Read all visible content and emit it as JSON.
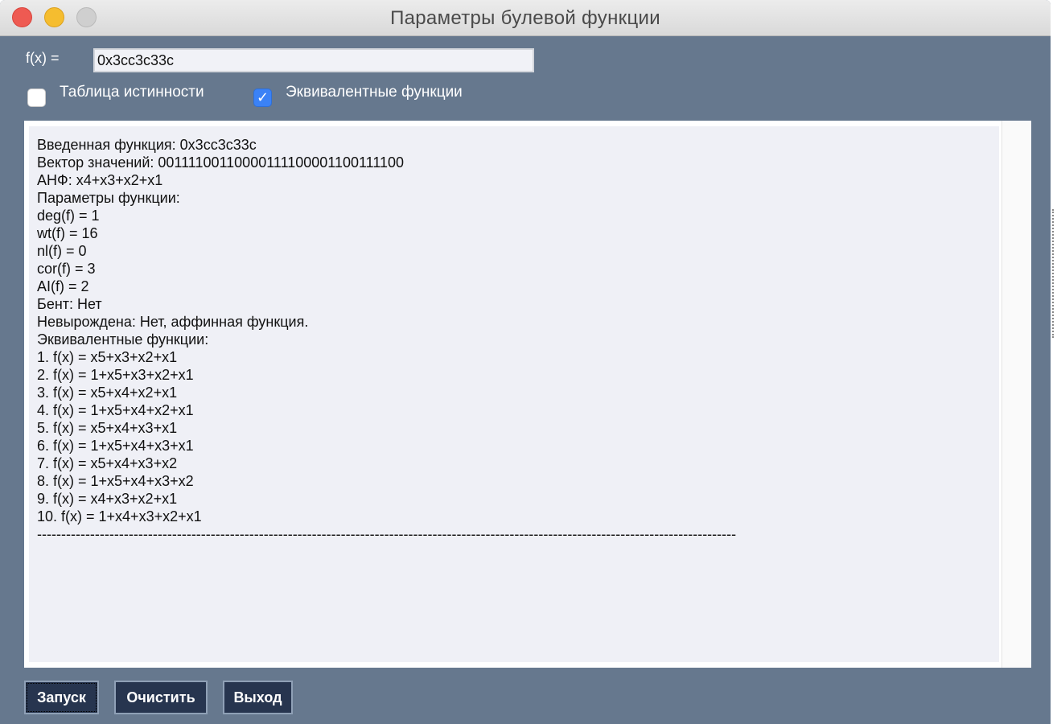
{
  "window": {
    "title": "Параметры булевой функции"
  },
  "form": {
    "fx_label": "f(x) =",
    "fx_value": "0x3cc3c33c"
  },
  "options": {
    "truth_table": {
      "label": "Таблица истинности",
      "checked": false
    },
    "equivalent": {
      "label": "Эквивалентные функции",
      "checked": true
    }
  },
  "output": {
    "lines": [
      "Введенная функция: 0x3cc3c33c",
      "Вектор значений: 00111100110000111100001100111100",
      "АНФ: x4+x3+x2+x1",
      "Параметры функции:",
      "deg(f) = 1",
      "wt(f) = 16",
      "nl(f) = 0",
      "cor(f) = 3",
      "AI(f) = 2",
      "Бент: Нет",
      "Невырождена: Нет, аффинная функция.",
      "Эквивалентные функции:",
      "1. f(x) = x5+x3+x2+x1",
      "2. f(x) = 1+x5+x3+x2+x1",
      "3. f(x) = x5+x4+x2+x1",
      "4. f(x) = 1+x5+x4+x2+x1",
      "5. f(x) = x5+x4+x3+x1",
      "6. f(x) = 1+x5+x4+x3+x1",
      "7. f(x) = x5+x4+x3+x2",
      "8. f(x) = 1+x5+x4+x3+x2",
      "9. f(x) = x4+x3+x2+x1",
      "10. f(x) = 1+x4+x3+x2+x1",
      "-------------------------------------------------------------------------------------------------------------------------------------------------"
    ]
  },
  "buttons": {
    "run": "Запуск",
    "clear": "Очистить",
    "exit": "Выход"
  },
  "colors": {
    "window_bg": "#66788e",
    "button_bg": "#27354f",
    "checkbox_on": "#3b82f6"
  }
}
